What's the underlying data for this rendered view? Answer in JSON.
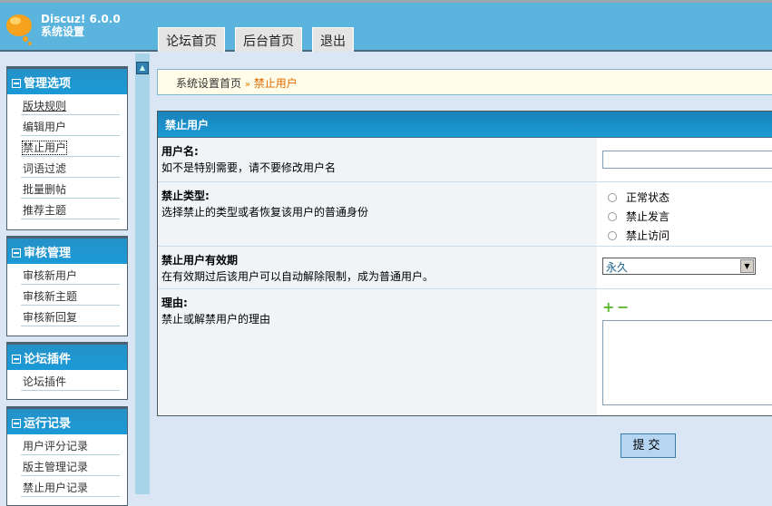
{
  "header": {
    "brand_line1": "Discuz! 6.0.0",
    "brand_line2": "系统设置",
    "tabs": [
      "论坛首页",
      "后台首页",
      "退出"
    ]
  },
  "sidebar": [
    {
      "title": "管理选项",
      "items": [
        "版块规则",
        "编辑用户",
        "禁止用户",
        "词语过滤",
        "批量删帖",
        "推荐主题"
      ]
    },
    {
      "title": "审核管理",
      "items": [
        "审核新用户",
        "审核新主题",
        "审核新回复"
      ]
    },
    {
      "title": "论坛插件",
      "items": [
        "论坛插件"
      ]
    },
    {
      "title": "运行记录",
      "items": [
        "用户评分记录",
        "版主管理记录",
        "禁止用户记录"
      ]
    }
  ],
  "breadcrumb": {
    "home": "系统设置首页",
    "sep": "»",
    "current": "禁止用户"
  },
  "form": {
    "title": "禁止用户",
    "username": {
      "label": "用户名:",
      "desc": "如不是特别需要，请不要修改用户名",
      "value": ""
    },
    "bantype": {
      "label": "禁止类型:",
      "desc": "选择禁止的类型或者恢复该用户的普通身份",
      "options": [
        "正常状态",
        "禁止发言",
        "禁止访问"
      ]
    },
    "duration": {
      "label": "禁止用户有效期",
      "desc": "在有效期过后该用户可以自动解除限制，成为普通用户。",
      "selected": "永久"
    },
    "reason": {
      "label": "理由:",
      "desc": "禁止或解禁用户的理由",
      "plus": "+",
      "minus": "−",
      "value": ""
    },
    "submit": "提交"
  }
}
